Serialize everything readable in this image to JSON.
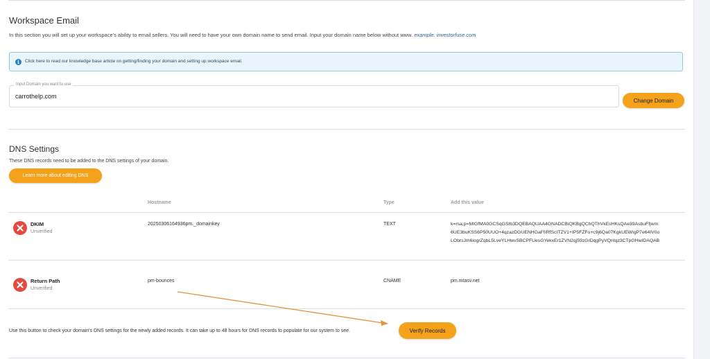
{
  "workspace": {
    "title": "Workspace Email",
    "description": "In this section you will set up your workspace's ability to email sellers. You will need to have your own domain name to send email. Input your domain name below without www.",
    "example": "example: investorfuse.com",
    "info_text": "Click here to read our knowledge base article on getting/finding your domain and setting up workspace email.",
    "domain_label": "Input Domain you want to use",
    "domain_value": "carrothelp.com",
    "change_button": "Change Domain"
  },
  "dns": {
    "title": "DNS Settings",
    "description": "These DNS records need to be added to the DNS settings of your domain.",
    "learn_button": "Learn more about editing DNS",
    "columns": {
      "hostname": "Hostname",
      "type": "Type",
      "value": "Add this value"
    },
    "records": [
      {
        "name": "DKIM",
        "status": "Unverified",
        "hostname": "20250306164936pm._domainkey",
        "type": "TEXT",
        "value_lines": [
          "k=rsa;p=MIGfMA0GCSqGSIb3DQEBAQUAA4GNADCBiQKBgQChQThVkEsHKsQAe39AsbuFfjwm",
          "6UE3buKSS6P50UUO+4qzazDGUENHGaFf/RfScITZV1+IP5FZFo+c9j6Qa07KgkUEWIgP7e64IV0o",
          "LObrsJm6iogrZqbL5LveYLHwvSBCPFUesGYekxEr1ZVN2qj59zGrDqgPyVQntqz3CTpGHwIDAQAB"
        ]
      },
      {
        "name": "Return Path",
        "status": "Unverified",
        "hostname": "pm-bounces",
        "type": "CNAME",
        "value_lines": [
          "pm.mtasv.net"
        ]
      }
    ],
    "verify_text": "Use this button to check your domain's DNS settings for the newly added records. It can take up to 48 hours for DNS records to populate for our system to see.",
    "verify_button": "Verify Records"
  },
  "colors": {
    "accent": "#f4a21a",
    "error": "#e8493f",
    "info_bg": "#e8f5fc",
    "annotation_arrow": "#e8913c"
  },
  "icons": {
    "info": "info-icon",
    "unverified": "close-circle-icon"
  }
}
